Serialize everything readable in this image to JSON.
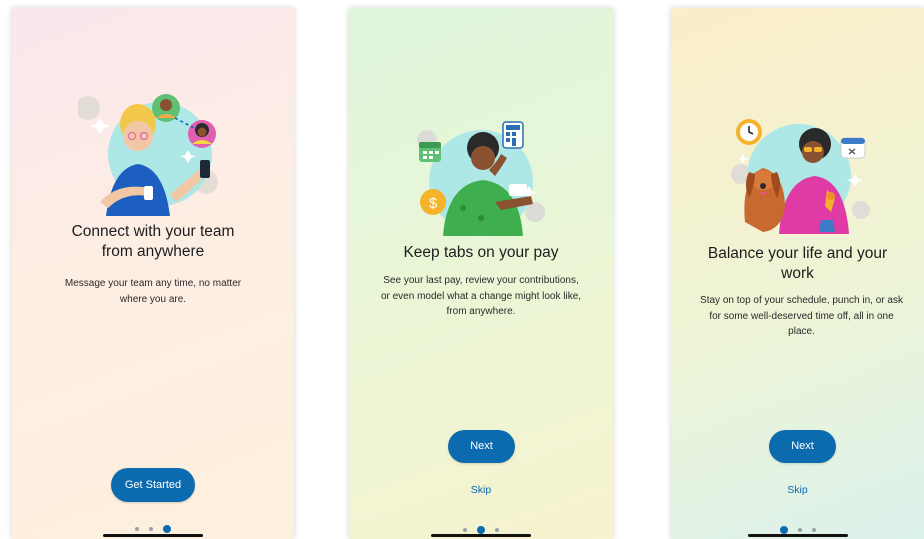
{
  "screens": [
    {
      "title_line1": "Connect with your team",
      "title_line2": "from anywhere",
      "desc_line1": "Message your team any time, no matter",
      "desc_line2": "where you are.",
      "button": "Get Started",
      "illustration": "person-with-phone-and-team-avatars"
    },
    {
      "title": "Keep tabs on your pay",
      "desc_line1": "See your last pay, review your contributions,",
      "desc_line2": "or even model what a change might look like,",
      "desc_line3": "from anywhere.",
      "button": "Next",
      "skip": "Skip",
      "illustration": "person-with-dollar-calendar-calculator"
    },
    {
      "title_line1": "Balance your life and your",
      "title_line2": "work",
      "desc_line1": "Stay on top of your schedule, punch in, or ask",
      "desc_line2": "for some well-deserved time off, all in one",
      "desc_line3": "place.",
      "button": "Next",
      "skip": "Skip",
      "illustration": "person-with-dog-clock-calendar"
    }
  ],
  "pagination": {
    "count": 3,
    "active_indices": [
      2,
      1,
      0
    ]
  },
  "colors": {
    "primary": "#0c6aae",
    "title_text": "#1d1d1f",
    "dot_inactive": "#9aa3ab"
  }
}
